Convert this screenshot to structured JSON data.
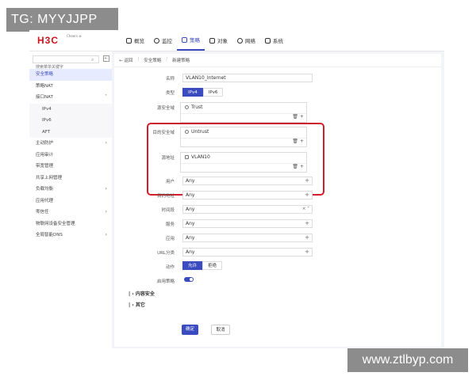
{
  "watermark": {
    "top_left": "TG: MYYJJPP",
    "bottom_right": "www.ztlbyp.com"
  },
  "brand": {
    "logo": "H3C",
    "sub": "Cheers ⊕"
  },
  "topnav": [
    {
      "label": "概览",
      "icon": "overview-icon"
    },
    {
      "label": "监控",
      "icon": "monitor-icon"
    },
    {
      "label": "策略",
      "icon": "policy-icon",
      "active": true
    },
    {
      "label": "对象",
      "icon": "object-icon"
    },
    {
      "label": "网络",
      "icon": "network-icon"
    },
    {
      "label": "系统",
      "icon": "system-icon"
    }
  ],
  "sidebar": {
    "search_placeholder": "搜索菜单关键字",
    "items": [
      {
        "label": "安全策略",
        "active": true
      },
      {
        "label": "策略NAT"
      },
      {
        "label": "接口NAT",
        "arrow": "˅"
      },
      {
        "label": "IPv4",
        "sub": true
      },
      {
        "label": "IPv6",
        "sub": true
      },
      {
        "label": "AFT",
        "sub": true
      },
      {
        "label": "主动防护",
        "arrow": "›"
      },
      {
        "label": "应用审计"
      },
      {
        "label": "带宽管理"
      },
      {
        "label": "共享上网管理"
      },
      {
        "label": "负载均衡",
        "arrow": "›"
      },
      {
        "label": "应用代理"
      },
      {
        "label": "零信任",
        "arrow": "›"
      },
      {
        "label": "物联网设备安全管理"
      },
      {
        "label": "全局智能DNS",
        "arrow": "›"
      }
    ]
  },
  "breadcrumb": {
    "back": "← 返回",
    "parent": "安全策略",
    "current": "新建策略"
  },
  "form": {
    "name_label": "名称",
    "name_value": "VLAN10_Internet",
    "type_label": "类型",
    "type_options": [
      "IPv4",
      "IPv6"
    ],
    "src_zone_label": "源安全域",
    "src_zone_value": "Trust",
    "dst_zone_label": "目的安全域",
    "dst_zone_value": "Untrust",
    "src_addr_label": "源地址",
    "src_addr_value": "VLAN10",
    "user_label": "用户",
    "user_value": "Any",
    "dst_addr_label": "目的地址",
    "dst_addr_value": "Any",
    "time_label": "时间段",
    "time_value": "Any",
    "service_label": "服务",
    "service_value": "Any",
    "app_label": "应用",
    "app_value": "Any",
    "url_label": "URL分类",
    "url_value": "Any",
    "action_label": "动作",
    "action_options": [
      "允许",
      "拒绝"
    ],
    "enable_label": "启用策略",
    "section_content": "| › 内容安全",
    "section_other": "| › 其它",
    "ok": "确定",
    "cancel": "取消"
  }
}
